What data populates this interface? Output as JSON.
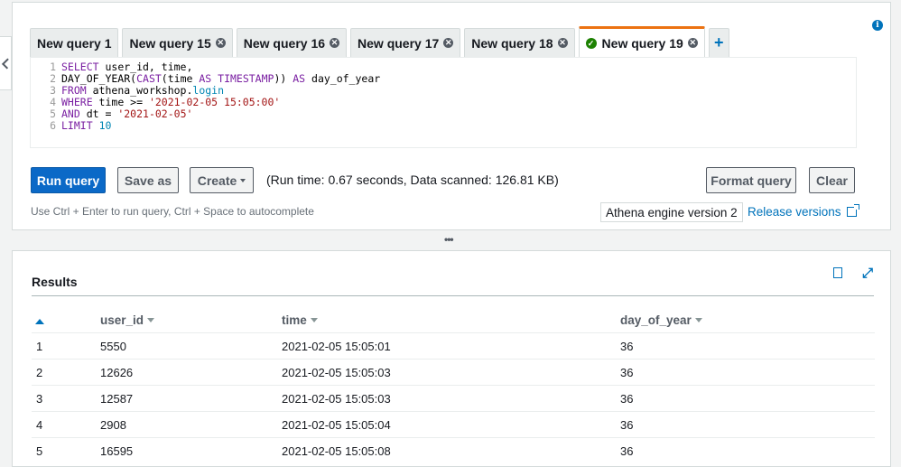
{
  "tabs": [
    {
      "label": "New query 1",
      "closable": false,
      "active": false
    },
    {
      "label": "New query 15",
      "closable": true,
      "active": false
    },
    {
      "label": "New query 16",
      "closable": true,
      "active": false
    },
    {
      "label": "New query 17",
      "closable": true,
      "active": false
    },
    {
      "label": "New query 18",
      "closable": true,
      "active": false
    },
    {
      "label": "New query 19",
      "closable": true,
      "active": true
    }
  ],
  "add_tab_label": "+",
  "editor": {
    "line_numbers": [
      "1",
      "2",
      "3",
      "4",
      "5",
      "6"
    ]
  },
  "toolbar": {
    "run_label": "Run query",
    "save_as_label": "Save as",
    "create_label": "Create",
    "run_info": "(Run time: 0.67 seconds, Data scanned: 126.81 KB)",
    "format_label": "Format query",
    "clear_label": "Clear"
  },
  "hint": "Use Ctrl + Enter to run query, Ctrl + Space to autocomplete",
  "engine_version": "Athena engine version 2",
  "release_versions": "Release versions",
  "results": {
    "title": "Results",
    "columns": [
      "user_id",
      "time",
      "day_of_year"
    ],
    "rows": [
      {
        "n": "1",
        "user_id": "5550",
        "time": "2021-02-05 15:05:01",
        "day_of_year": "36"
      },
      {
        "n": "2",
        "user_id": "12626",
        "time": "2021-02-05 15:05:03",
        "day_of_year": "36"
      },
      {
        "n": "3",
        "user_id": "12587",
        "time": "2021-02-05 15:05:03",
        "day_of_year": "36"
      },
      {
        "n": "4",
        "user_id": "2908",
        "time": "2021-02-05 15:05:04",
        "day_of_year": "36"
      },
      {
        "n": "5",
        "user_id": "16595",
        "time": "2021-02-05 15:05:08",
        "day_of_year": "36"
      }
    ]
  },
  "colors": {
    "accent": "#ec7211",
    "primary": "#0b69c7",
    "link": "#0073bb"
  }
}
